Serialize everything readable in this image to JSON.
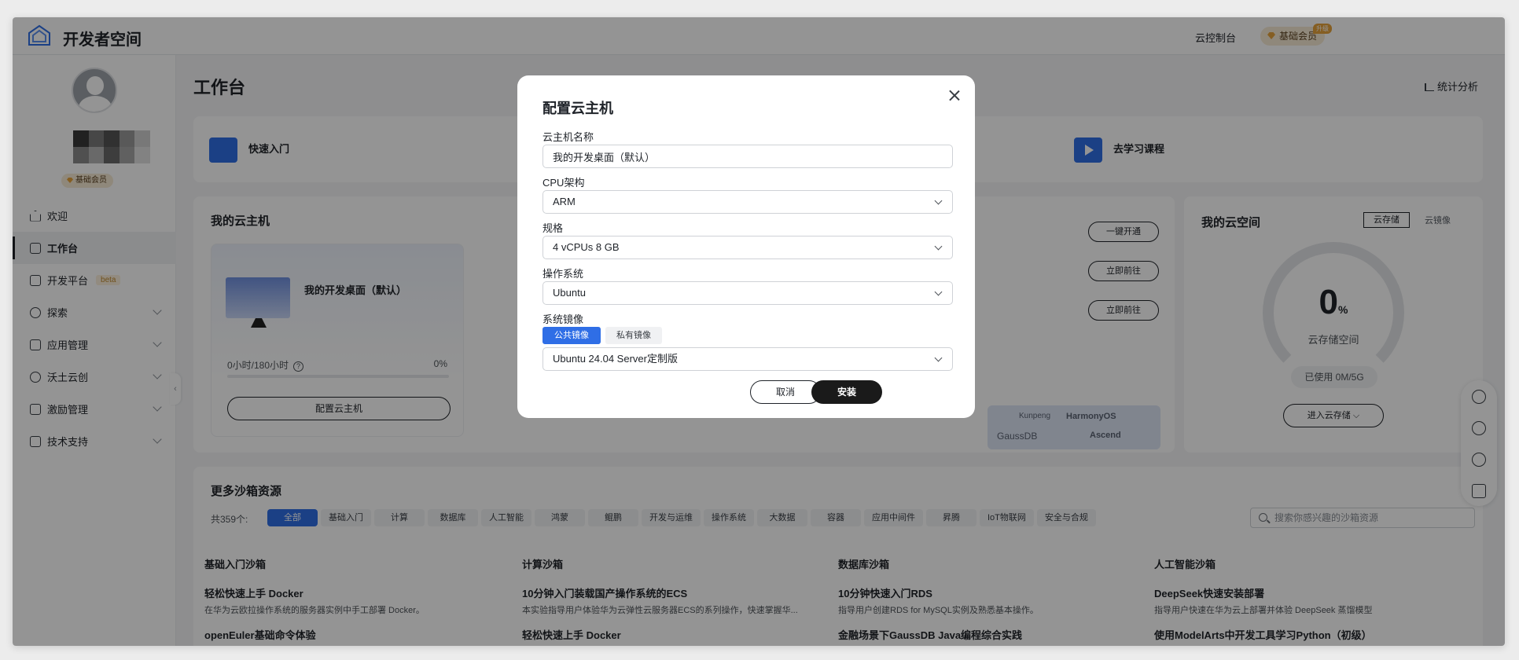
{
  "topbar": {
    "brand": "开发者空间",
    "console_label": "云控制台",
    "vip_label": "基础会员",
    "upgrade_tag": "升级"
  },
  "sidebar": {
    "vip_label": "基础会员",
    "items": [
      {
        "label": "欢迎",
        "icon": "home-icon"
      },
      {
        "label": "工作台",
        "icon": "workbench-icon",
        "active": true
      },
      {
        "label": "开发平台",
        "icon": "dev-platform-icon",
        "badge": "beta"
      },
      {
        "label": "探索",
        "icon": "explore-icon"
      },
      {
        "label": "应用管理",
        "icon": "app-manage-icon"
      },
      {
        "label": "沃土云创",
        "icon": "cloud-create-icon"
      },
      {
        "label": "激励管理",
        "icon": "gift-icon"
      },
      {
        "label": "技术支持",
        "icon": "support-icon"
      }
    ]
  },
  "main": {
    "title": "工作台",
    "stats_link": "统计分析",
    "quick": {
      "item1": "快速入门",
      "item2": "去学习课程"
    }
  },
  "cloud_panel": {
    "title": "我的云主机",
    "host_name": "我的开发桌面（默认）",
    "usage_text": "0小时/180小时",
    "usage_pct": "0%",
    "usage_fraction": 0,
    "configure_button": "配置云主机",
    "buttons": [
      "一键开通",
      "立即前往",
      "立即前往"
    ],
    "logos": [
      "Kunpeng",
      "HarmonyOS",
      "GaussDB",
      "Ascend"
    ]
  },
  "space_panel": {
    "title": "我的云空间",
    "tab_storage": "云存储",
    "tab_image": "云镜像",
    "value": "0",
    "unit": "%",
    "label": "云存储空间",
    "used": "已使用   0M/5G",
    "enter_button": "进入云存储"
  },
  "sandbox": {
    "title": "更多沙箱资源",
    "count": "共359个:",
    "filters": [
      "全部",
      "基础入门",
      "计算",
      "数据库",
      "人工智能",
      "鸿蒙",
      "鲲鹏",
      "开发与运维",
      "操作系统",
      "大数据",
      "容器",
      "应用中间件",
      "昇腾",
      "IoT物联网",
      "安全与合规"
    ],
    "search_placeholder": "搜索你感兴趣的沙箱资源",
    "columns": [
      {
        "title": "基础入门沙箱",
        "items": [
          {
            "name": "轻松快速上手 Docker",
            "desc": "在华为云欧拉操作系统的服务器实例中手工部署 Docker。"
          },
          {
            "name": "openEuler基础命令体验",
            "desc": ""
          }
        ]
      },
      {
        "title": "计算沙箱",
        "items": [
          {
            "name": "10分钟入门装载国产操作系统的ECS",
            "desc": "本实验指导用户体验华为云弹性云服务器ECS的系列操作，快速掌握华..."
          },
          {
            "name": "轻松快速上手 Docker",
            "desc": ""
          }
        ]
      },
      {
        "title": "数据库沙箱",
        "items": [
          {
            "name": "10分钟快速入门RDS",
            "desc": "指导用户创建RDS for MySQL实例及熟悉基本操作。"
          },
          {
            "name": "金融场景下GaussDB Java编程综合实践",
            "desc": ""
          }
        ]
      },
      {
        "title": "人工智能沙箱",
        "items": [
          {
            "name": "DeepSeek快速安装部署",
            "desc": "指导用户快速在华为云上部署并体验 DeepSeek 蒸馏模型"
          },
          {
            "name": "使用ModelArts中开发工具学习Python（初级）",
            "desc": ""
          }
        ]
      }
    ]
  },
  "modal": {
    "title": "配置云主机",
    "name_label": "云主机名称",
    "name_value": "我的开发桌面（默认）",
    "cpu_label": "CPU架构",
    "cpu_value": "ARM",
    "spec_label": "规格",
    "spec_value": "4 vCPUs 8 GB",
    "os_label": "操作系统",
    "os_value": "Ubuntu",
    "image_label": "系统镜像",
    "tab_public": "公共镜像",
    "tab_private": "私有镜像",
    "image_value": "Ubuntu 24.04 Server定制版",
    "cancel": "取消",
    "install": "安装"
  },
  "colors": {
    "accent": "#2f6ee6",
    "vip": "#e6a23c",
    "dark_button": "#1a1a1a"
  }
}
